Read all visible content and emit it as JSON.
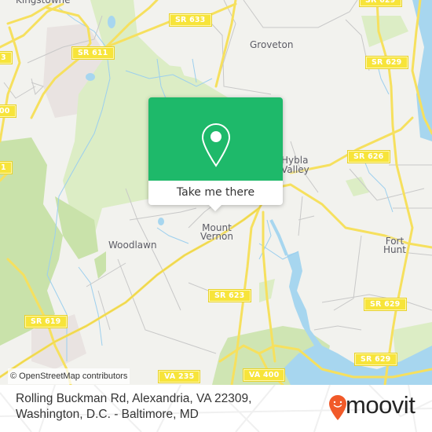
{
  "map": {
    "colors": {
      "background": "#f2f2ee",
      "park": "#d9ebc0",
      "park_dark": "#c6e1a6",
      "water": "#a7d6ef",
      "road_major": "#f6e05e",
      "road_minor": "#c8c8c8",
      "urban": "#e9e3e1",
      "accent": "#1eb96a"
    },
    "place_labels": [
      {
        "id": "kingstowne",
        "text": "Kingstowne"
      },
      {
        "id": "groveton",
        "text": "Groveton"
      },
      {
        "id": "hybla-valley",
        "text": "Hybla\nValley"
      },
      {
        "id": "woodlawn",
        "text": "Woodlawn"
      },
      {
        "id": "mount-vernon",
        "text": "Mount\nVernon"
      },
      {
        "id": "fort-hunt",
        "text": "Fort\nHunt"
      }
    ],
    "road_shields": [
      {
        "id": "sr633",
        "text": "SR 633"
      },
      {
        "id": "sr611",
        "text": "SR 611"
      },
      {
        "id": "sr629-top",
        "text": "SR 629"
      },
      {
        "id": "sr629-top2",
        "text": "SR 629"
      },
      {
        "id": "sr626",
        "text": "SR 626"
      },
      {
        "id": "sr623",
        "text": "SR 623"
      },
      {
        "id": "sr629-mid",
        "text": "SR 629"
      },
      {
        "id": "sr629-low",
        "text": "SR 629"
      },
      {
        "id": "sr619",
        "text": "SR 619"
      },
      {
        "id": "va400",
        "text": "VA 400"
      },
      {
        "id": "va235",
        "text": "VA 235"
      },
      {
        "id": "left-edge-1",
        "text": "3"
      },
      {
        "id": "left-edge-2",
        "text": "00"
      },
      {
        "id": "left-edge-3",
        "text": "1"
      }
    ],
    "attribution": "© OpenStreetMap contributors"
  },
  "popup": {
    "icon": "map-pin-icon",
    "button_label": "Take me there"
  },
  "footer": {
    "address": "Rolling Buckman Rd, Alexandria, VA 22309, Washington, D.C. - Baltimore, MD",
    "logo_text": "moovit",
    "logo_color": "#f15a29"
  }
}
